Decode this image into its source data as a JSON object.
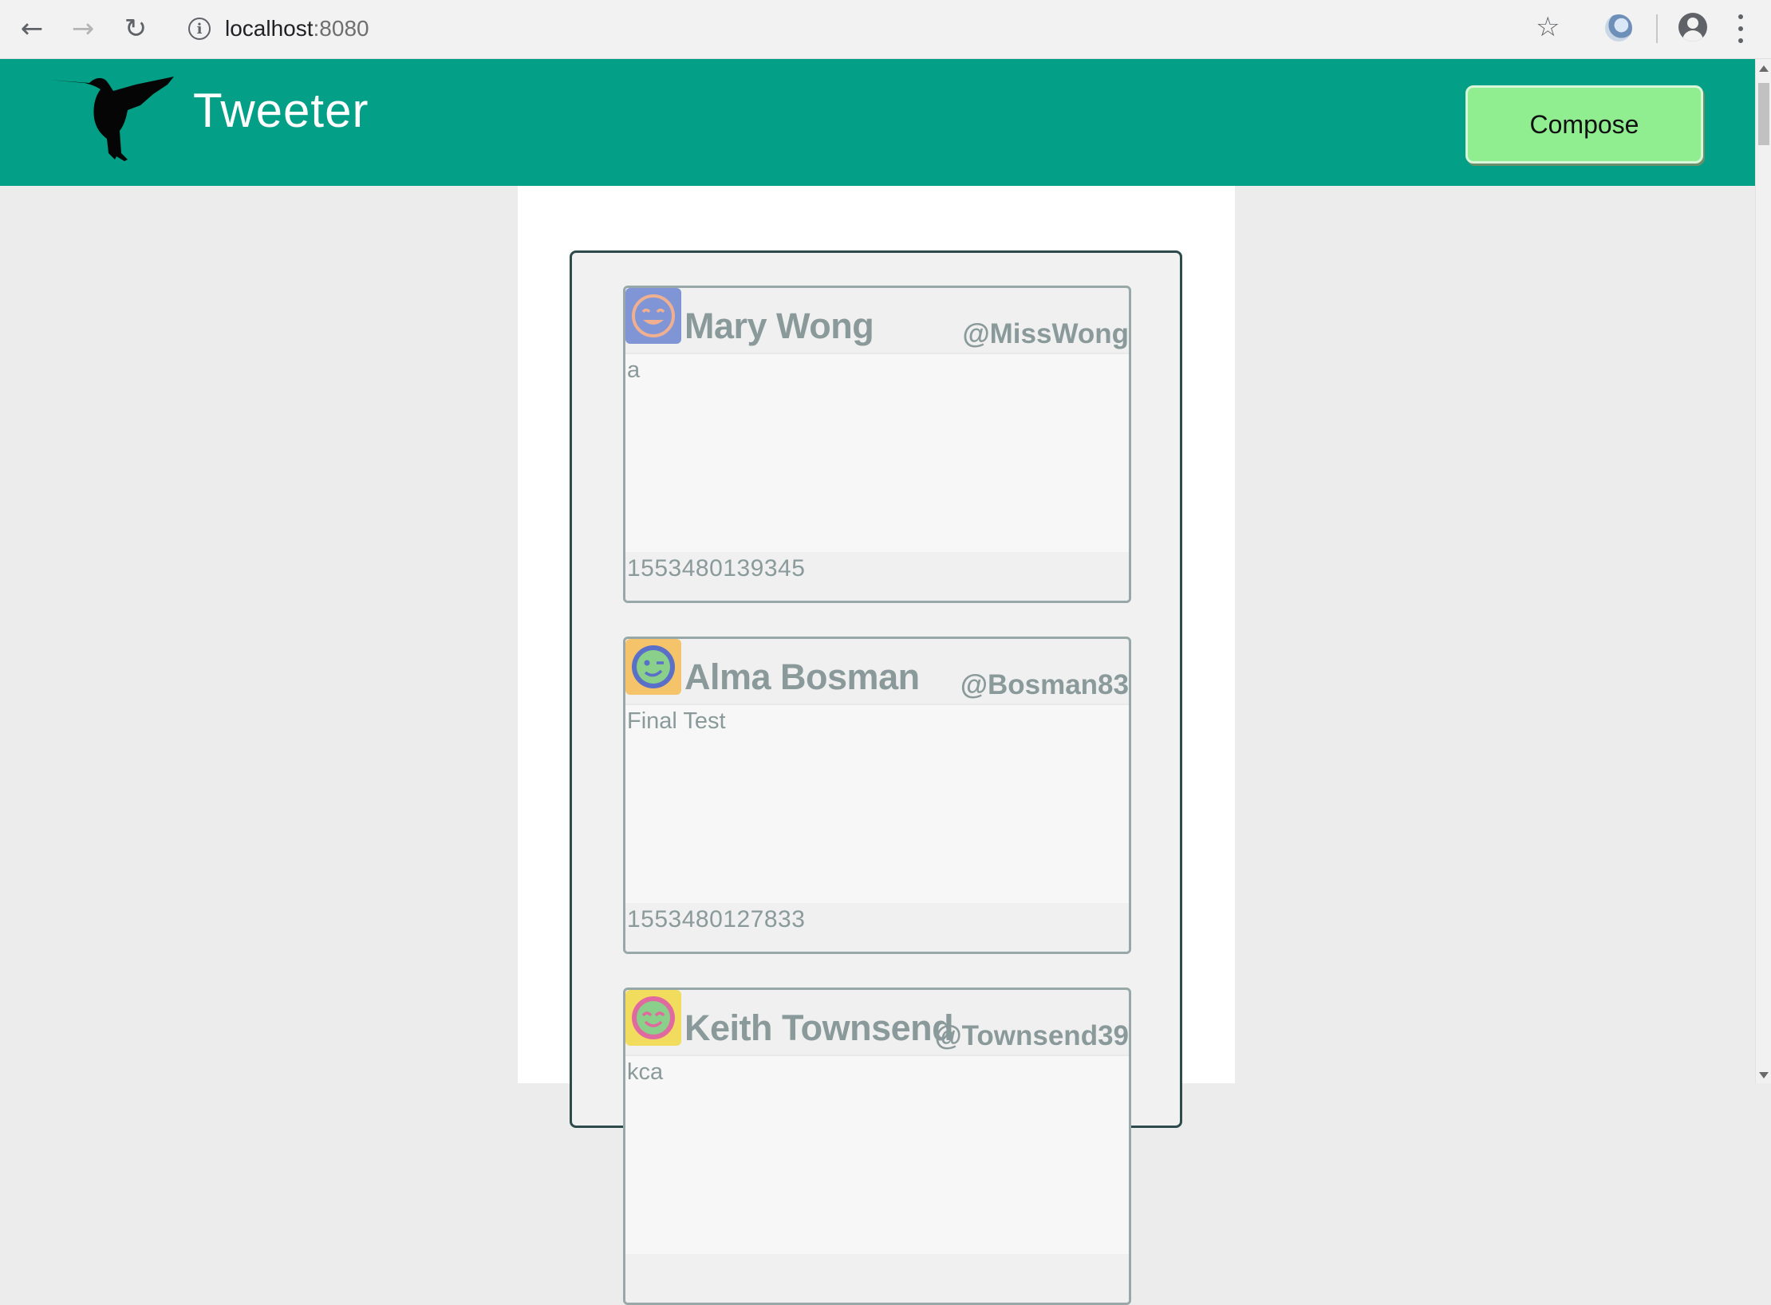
{
  "browser": {
    "url_host": "localhost",
    "url_port": ":8080"
  },
  "app": {
    "title": "Tweeter",
    "compose_label": "Compose",
    "accent_color": "#03a087",
    "compose_color": "#90ee90"
  },
  "tweets": [
    {
      "name": "Mary Wong",
      "handle": "@MissWong",
      "text": "a",
      "timestamp": "1553480139345",
      "avatar": {
        "bg": "#7f95d6",
        "face": "#f0b090",
        "icon": "smiling-face-icon"
      }
    },
    {
      "name": "Alma Bosman",
      "handle": "@Bosman83",
      "text": "Final Test",
      "timestamp": "1553480127833",
      "avatar": {
        "bg": "#f5c36a",
        "face": "#5a6fc8",
        "icon": "winking-face-icon"
      }
    },
    {
      "name": "Keith Townsend",
      "handle": "@Townsend39",
      "text": "kca",
      "timestamp": "",
      "avatar": {
        "bg": "#f2dc5e",
        "face": "#e06aa0",
        "icon": "happy-face-icon"
      }
    }
  ]
}
